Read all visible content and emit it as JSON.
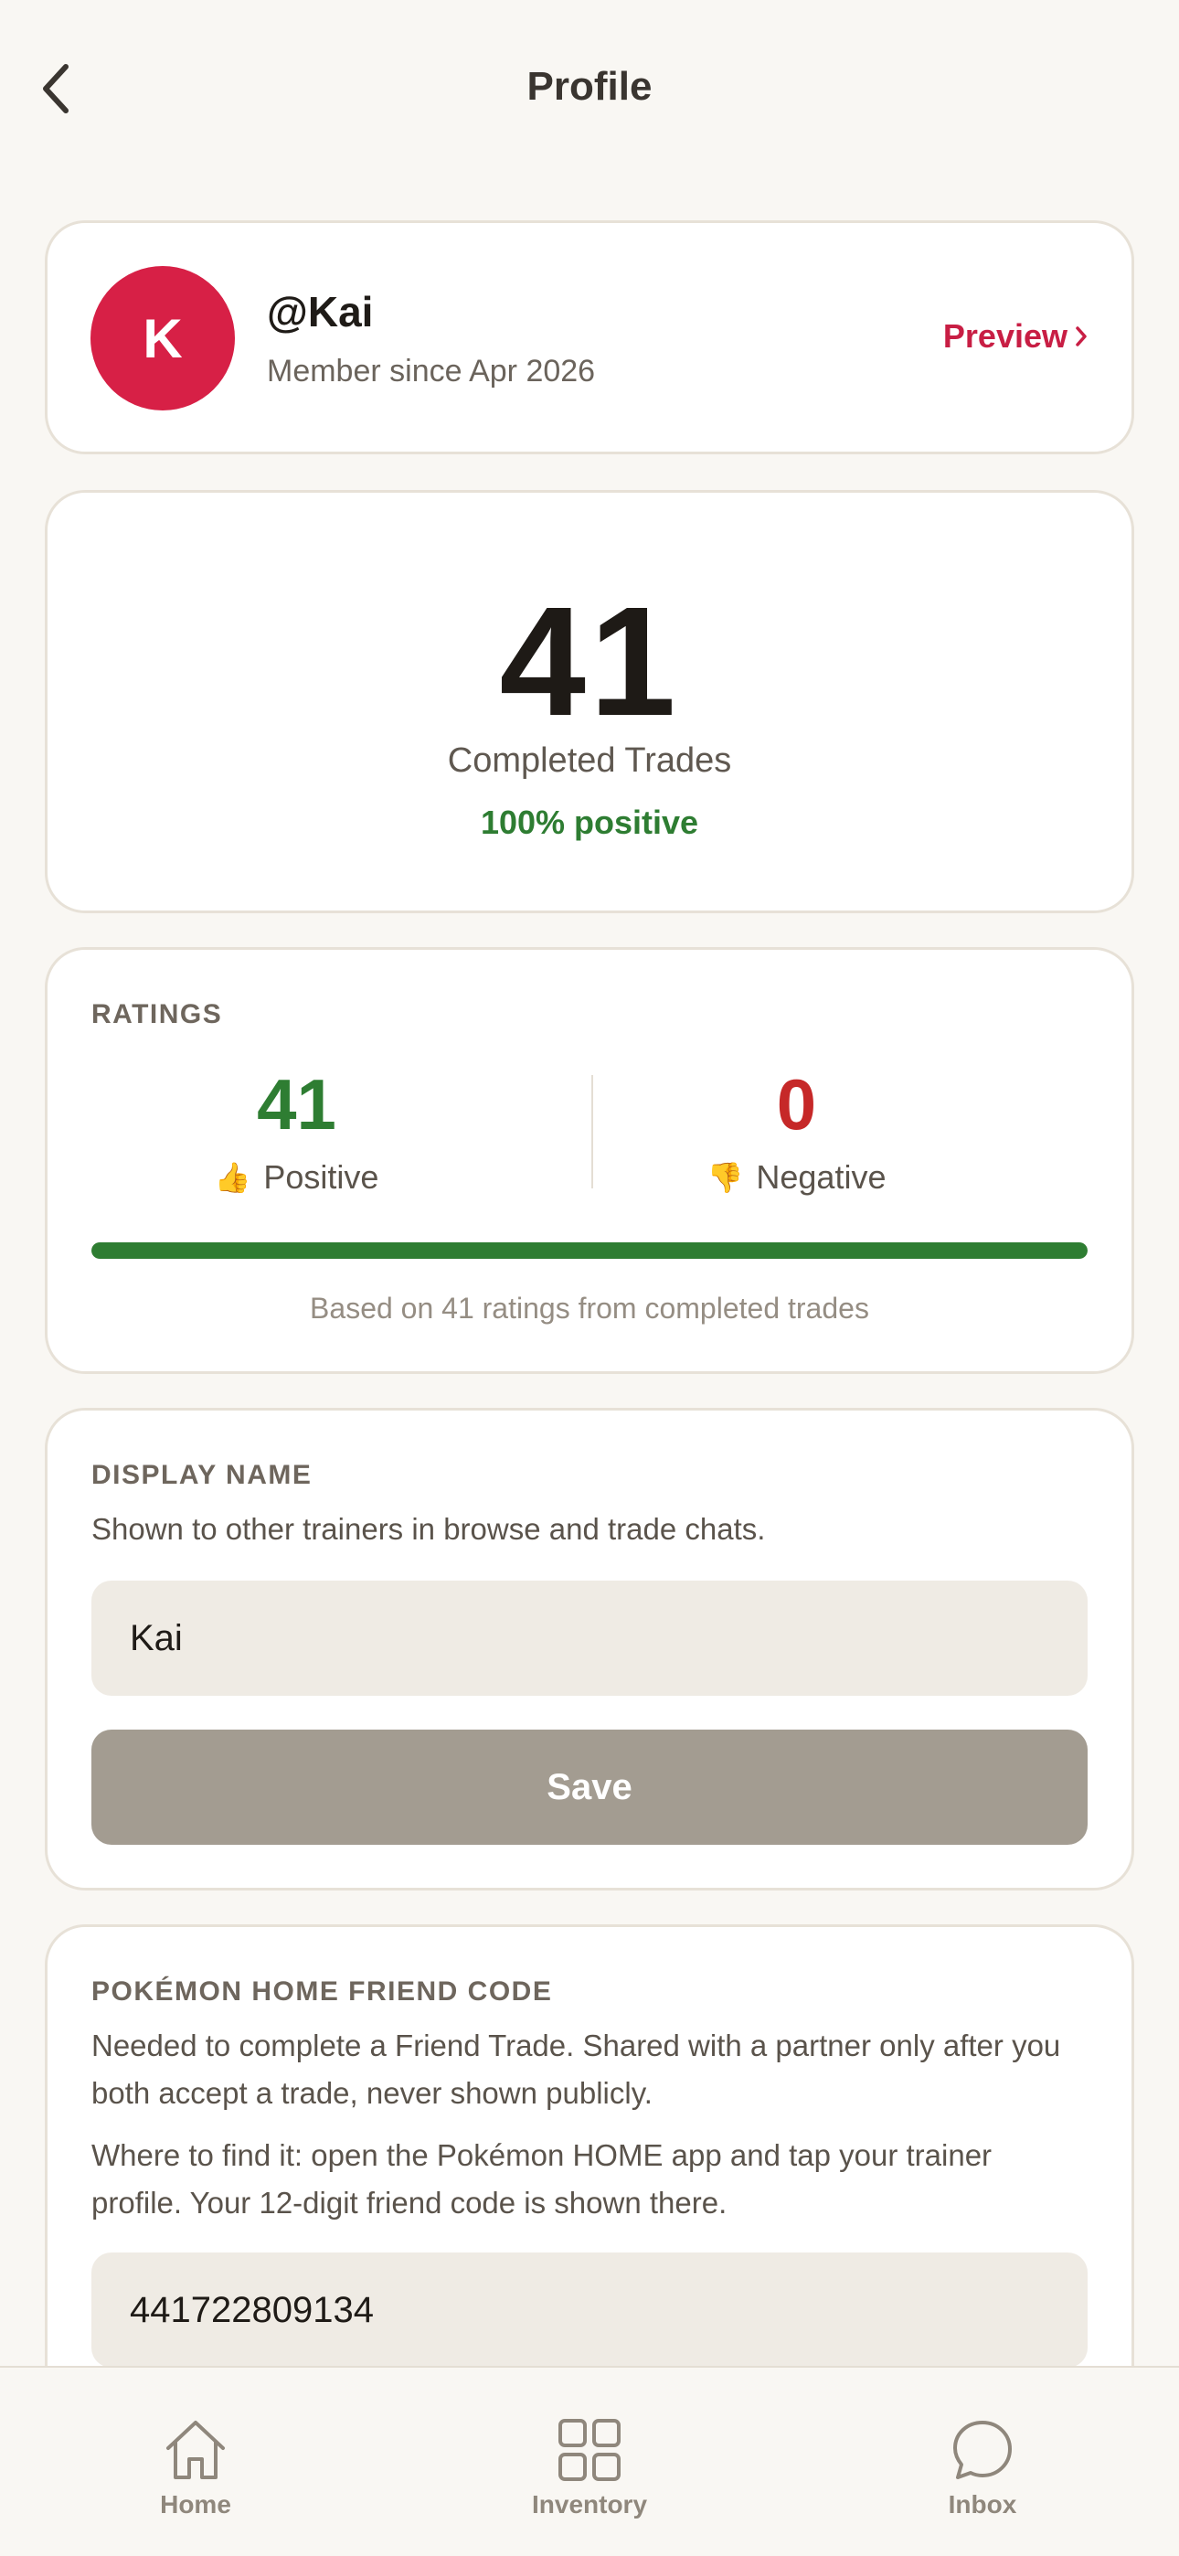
{
  "header": {
    "title": "Profile"
  },
  "profile": {
    "avatar_initial": "K",
    "username": "@Kai",
    "member_since": "Member since Apr 2026",
    "preview_label": "Preview"
  },
  "trades": {
    "count": "41",
    "label": "Completed Trades",
    "positive_text": "100% positive"
  },
  "ratings": {
    "section_label": "RATINGS",
    "positive_count": "41",
    "positive_label": "Positive",
    "negative_count": "0",
    "negative_label": "Negative",
    "positive_fraction": 1.0,
    "footnote": "Based on 41 ratings from completed trades"
  },
  "display_name": {
    "section_label": "DISPLAY NAME",
    "description": "Shown to other trainers in browse and trade chats.",
    "value": "Kai",
    "save_label": "Save"
  },
  "friend_code": {
    "section_label": "POKÉMON HOME FRIEND CODE",
    "description_1": "Needed to complete a Friend Trade. Shared with a partner only after you both accept a trade, never shown publicly.",
    "description_2": "Where to find it: open the Pokémon HOME app and tap your trainer profile. Your 12-digit friend code is shown there.",
    "value": "441722809134"
  },
  "tabbar": {
    "items": [
      {
        "label": "Home",
        "icon": "home-icon"
      },
      {
        "label": "Inventory",
        "icon": "grid-icon"
      },
      {
        "label": "Inbox",
        "icon": "chat-bubble-icon"
      }
    ]
  },
  "colors": {
    "brand": "#d72046",
    "positive": "#2e7d32",
    "negative": "#c62828",
    "background": "#f9f7f3"
  }
}
